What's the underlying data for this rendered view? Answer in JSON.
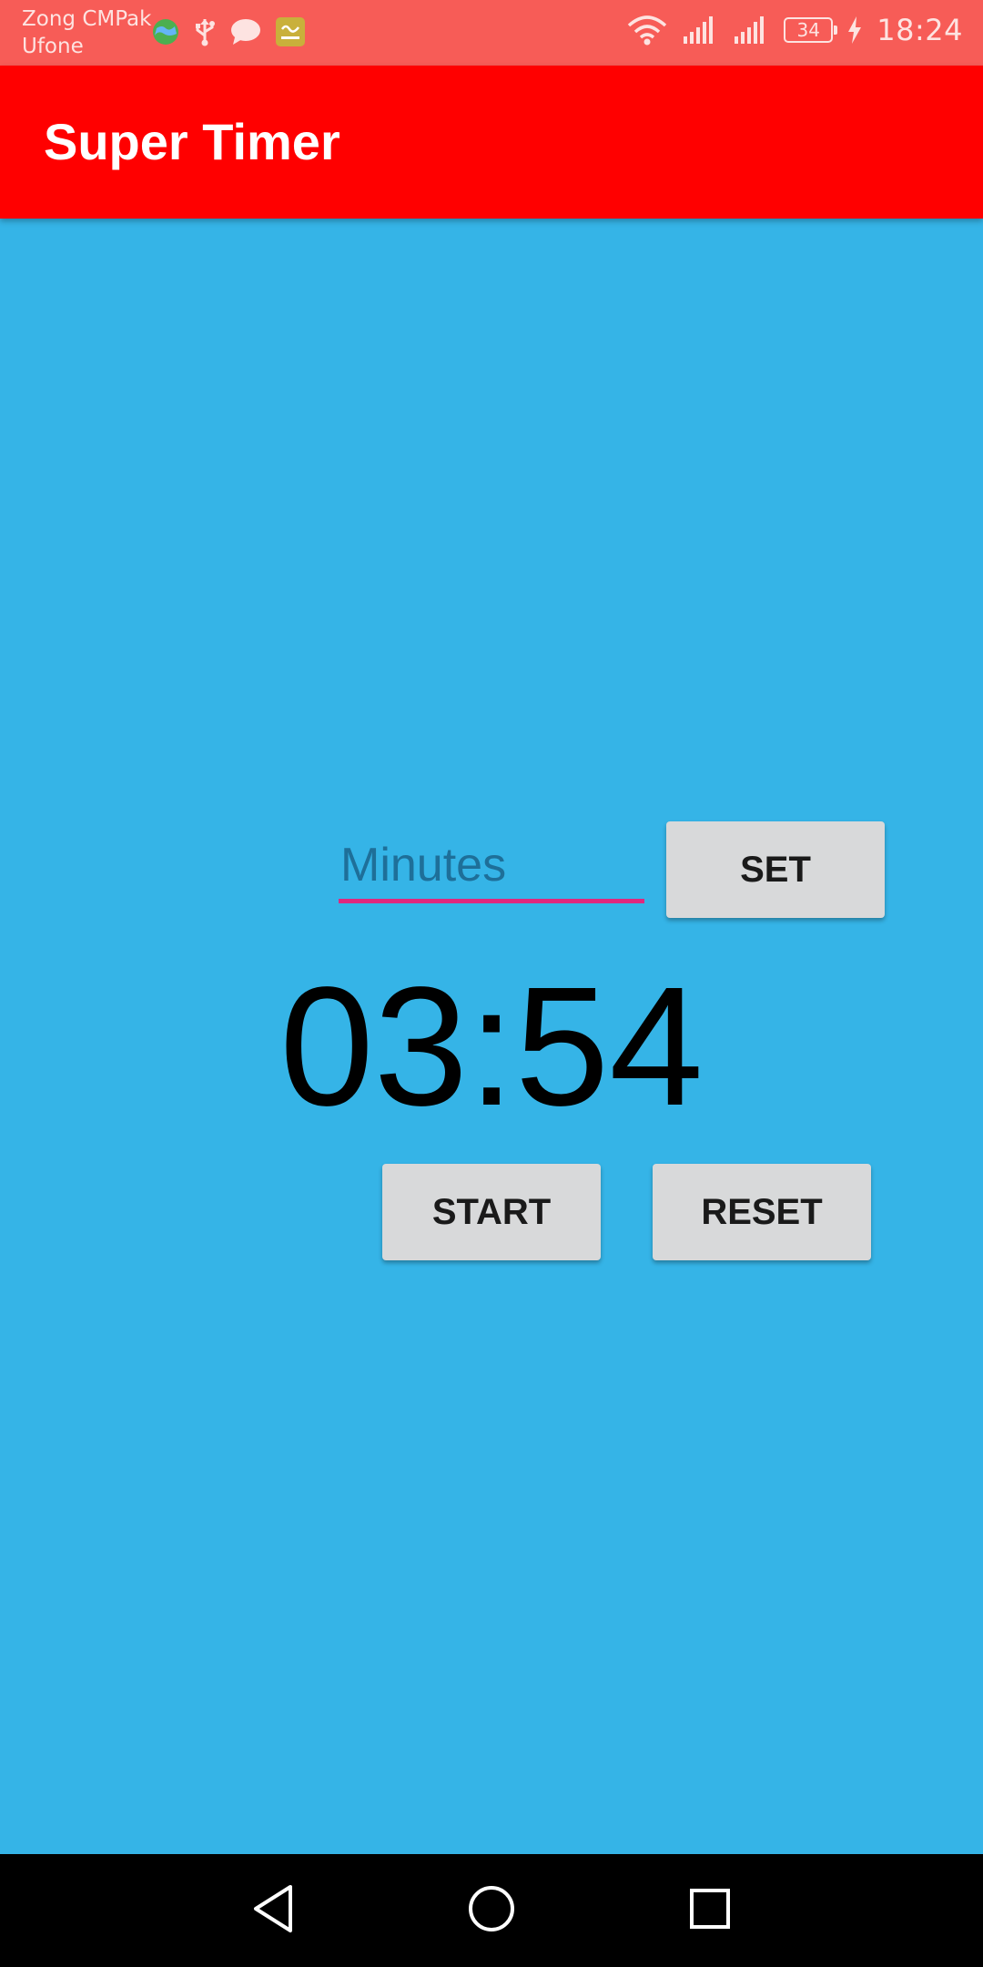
{
  "status_bar": {
    "carrier_primary": "Zong CMPak",
    "carrier_secondary": "Ufone",
    "battery_level": "34",
    "time": "18:24",
    "background_color": "#f75c57"
  },
  "app_bar": {
    "title": "Super Timer",
    "background_color": "#ff0000"
  },
  "timer": {
    "minutes_placeholder": "Minutes",
    "minutes_value": "",
    "set_label": "SET",
    "display": "03:54",
    "start_label": "START",
    "reset_label": "RESET",
    "background_color": "#35b4e7",
    "input_underline_color": "#e0287e"
  },
  "navigation": {
    "back": "back-icon",
    "home": "home-icon",
    "recent": "recent-apps-icon"
  }
}
